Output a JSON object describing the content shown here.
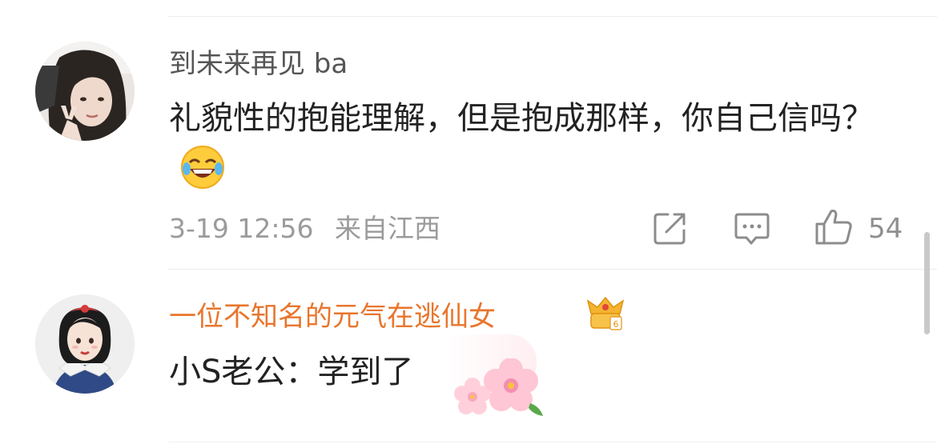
{
  "comments": [
    {
      "username": "到未来再见 ba",
      "text": "礼貌性的抱能理解，但是抱成那样，你自己信吗？",
      "emoji": "laughing-tears-emoji",
      "date": "3-19 12:56",
      "location": "来自江西",
      "like_count": "54",
      "actions": [
        "share-icon",
        "comment-icon",
        "like-icon"
      ]
    },
    {
      "username": "一位不知名的元气在逃仙女",
      "username_color": "#e8762d",
      "badge": "crown-badge-icon",
      "text": "小S老公：学到了",
      "decoration": "cherry-blossom-bubble"
    }
  ]
}
